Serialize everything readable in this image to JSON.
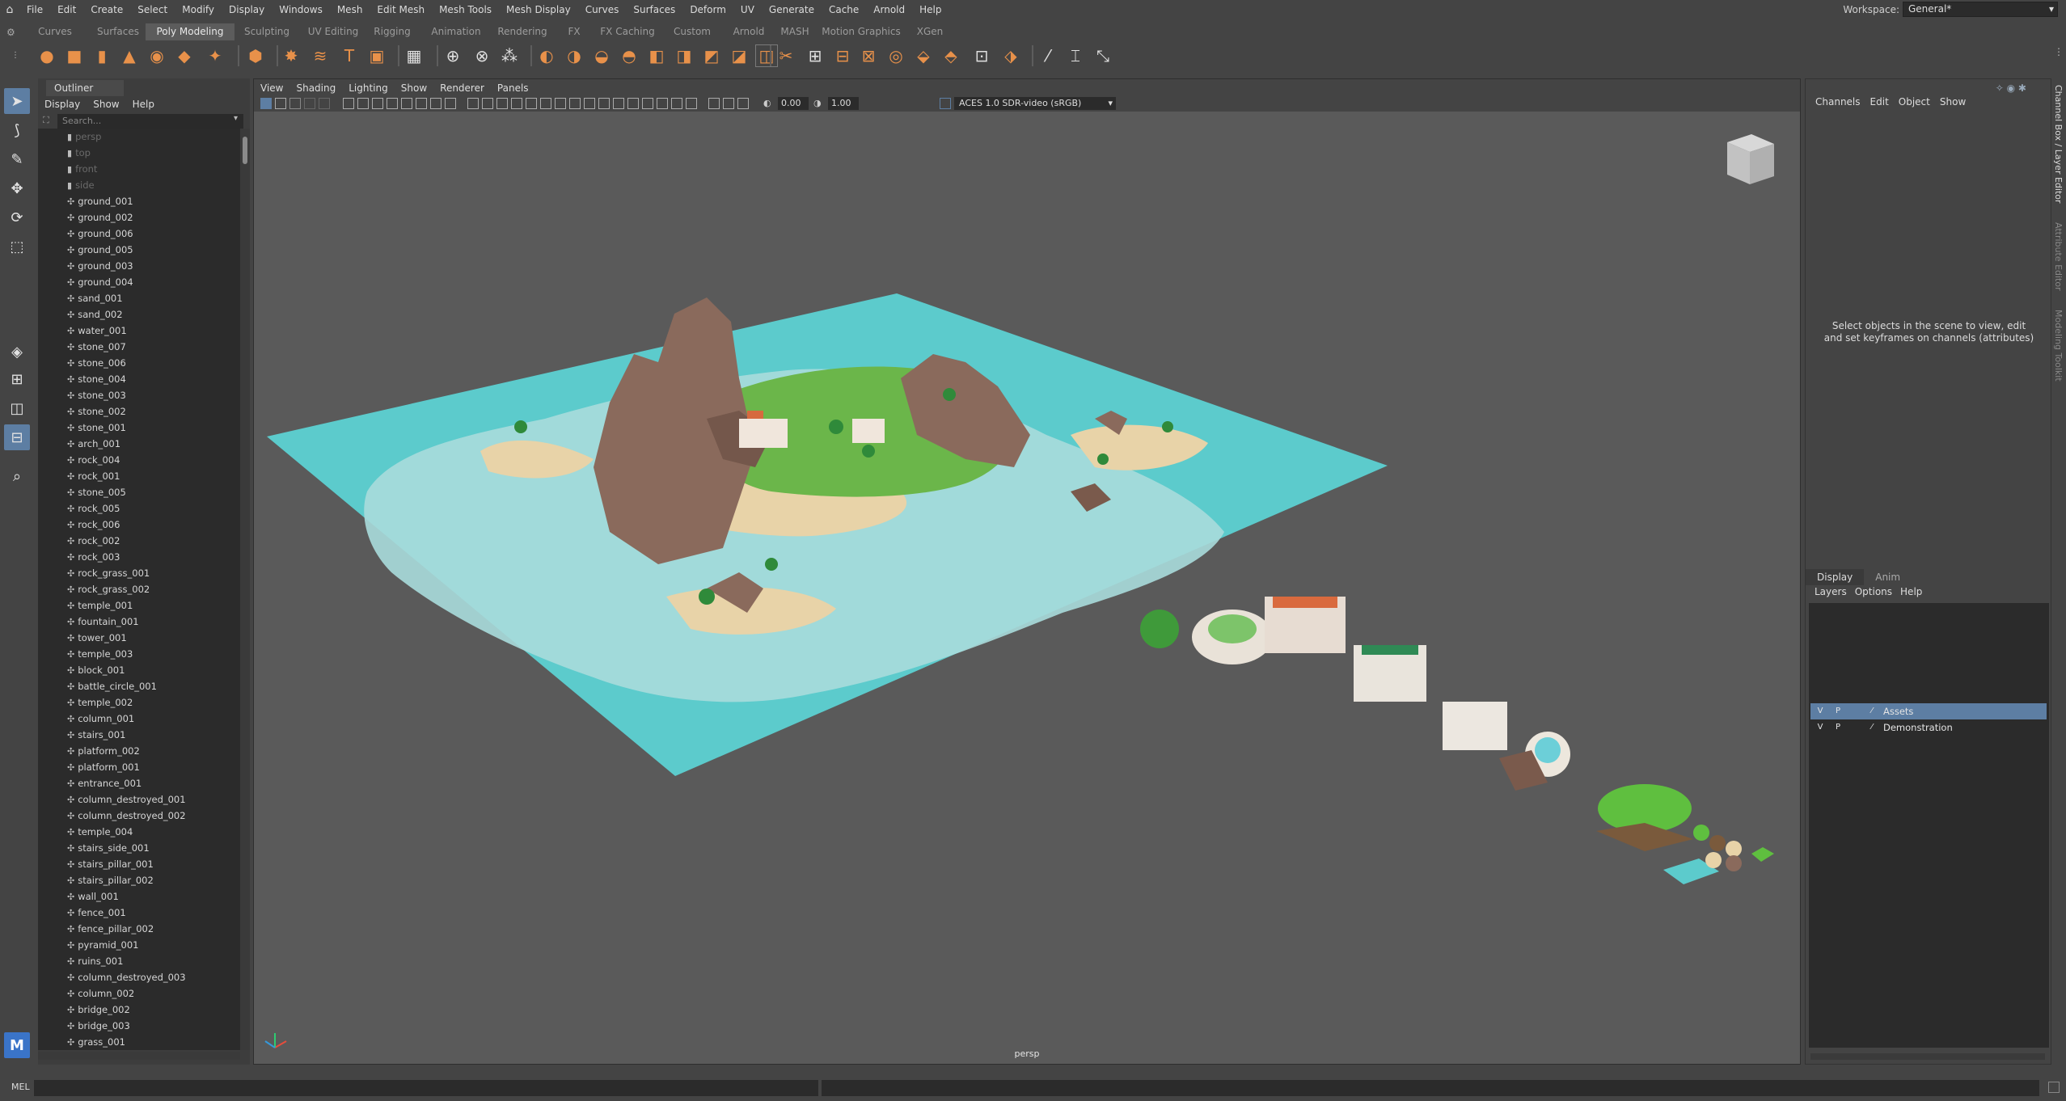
{
  "menubar": {
    "items": [
      "File",
      "Edit",
      "Create",
      "Select",
      "Modify",
      "Display",
      "Windows",
      "Mesh",
      "Edit Mesh",
      "Mesh Tools",
      "Mesh Display",
      "Curves",
      "Surfaces",
      "Deform",
      "UV",
      "Generate",
      "Cache",
      "Arnold",
      "Help"
    ],
    "workspace_label": "Workspace:",
    "workspace_value": "General*"
  },
  "shelf_tabs": [
    "Curves",
    "Surfaces",
    "Poly Modeling",
    "Sculpting",
    "UV Editing",
    "Rigging",
    "Animation",
    "Rendering",
    "FX",
    "FX Caching",
    "Custom",
    "Arnold",
    "MASH",
    "Motion Graphics",
    "XGen"
  ],
  "shelf_active": "Poly Modeling",
  "outliner": {
    "tab": "Outliner",
    "menu": [
      "Display",
      "Show",
      "Help"
    ],
    "search_placeholder": "Search...",
    "cameras": [
      "persp",
      "top",
      "front",
      "side"
    ],
    "items": [
      "ground_001",
      "ground_002",
      "ground_006",
      "ground_005",
      "ground_003",
      "ground_004",
      "sand_001",
      "sand_002",
      "water_001",
      "stone_007",
      "stone_006",
      "stone_004",
      "stone_003",
      "stone_002",
      "stone_001",
      "arch_001",
      "rock_004",
      "rock_001",
      "stone_005",
      "rock_005",
      "rock_006",
      "rock_002",
      "rock_003",
      "rock_grass_001",
      "rock_grass_002",
      "temple_001",
      "fountain_001",
      "tower_001",
      "temple_003",
      "block_001",
      "battle_circle_001",
      "temple_002",
      "column_001",
      "stairs_001",
      "platform_002",
      "platform_001",
      "entrance_001",
      "column_destroyed_001",
      "column_destroyed_002",
      "temple_004",
      "stairs_side_001",
      "stairs_pillar_001",
      "stairs_pillar_002",
      "wall_001",
      "fence_001",
      "fence_pillar_002",
      "pyramid_001",
      "ruins_001",
      "column_destroyed_003",
      "column_002",
      "bridge_002",
      "bridge_003",
      "grass_001"
    ]
  },
  "viewport": {
    "menu": [
      "View",
      "Shading",
      "Lighting",
      "Show",
      "Renderer",
      "Panels"
    ],
    "exposure": "0.00",
    "gamma": "1.00",
    "color_space": "ACES 1.0 SDR-video (sRGB)",
    "camera_label": "persp"
  },
  "channel_box": {
    "menu": [
      "Channels",
      "Edit",
      "Object",
      "Show"
    ],
    "hint": "Select objects in the scene to view, edit and set keyframes on channels (attributes)"
  },
  "layer_editor": {
    "tabs": [
      "Display",
      "Anim"
    ],
    "menu": [
      "Layers",
      "Options",
      "Help"
    ],
    "layers": [
      {
        "v": "V",
        "p": "P",
        "name": "Assets",
        "selected": true
      },
      {
        "v": "V",
        "p": "P",
        "name": "Demonstration",
        "selected": false
      }
    ]
  },
  "side_tabs": [
    "Channel Box / Layer Editor",
    "Attribute Editor",
    "Modeling Toolkit"
  ],
  "command_line": {
    "label": "MEL"
  }
}
